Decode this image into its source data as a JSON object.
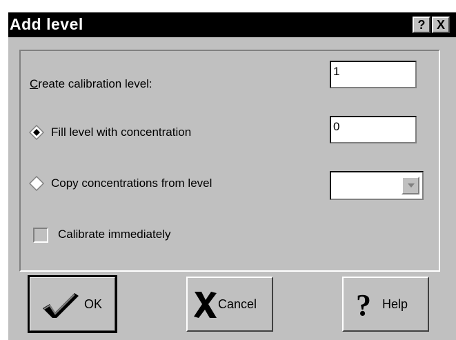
{
  "window": {
    "title": "Add level",
    "help_button": "?",
    "close_button": "X"
  },
  "fields": {
    "calibration_level": {
      "label": "Create calibration level:",
      "mnemonic": "C",
      "label_rest": "reate calibration level:",
      "value": "1"
    },
    "fill_level": {
      "label": "Fill level with concentration",
      "value": "0",
      "selected": true
    },
    "copy_level": {
      "label": "Copy concentrations from level",
      "value": "",
      "selected": false
    },
    "calibrate": {
      "label": "Calibrate immediately",
      "checked": false
    }
  },
  "buttons": {
    "ok": "OK",
    "cancel": "Cancel",
    "help": "Help"
  },
  "icons": {
    "ok": "checkmark-icon",
    "cancel": "x-icon",
    "help": "question-mark-icon"
  }
}
